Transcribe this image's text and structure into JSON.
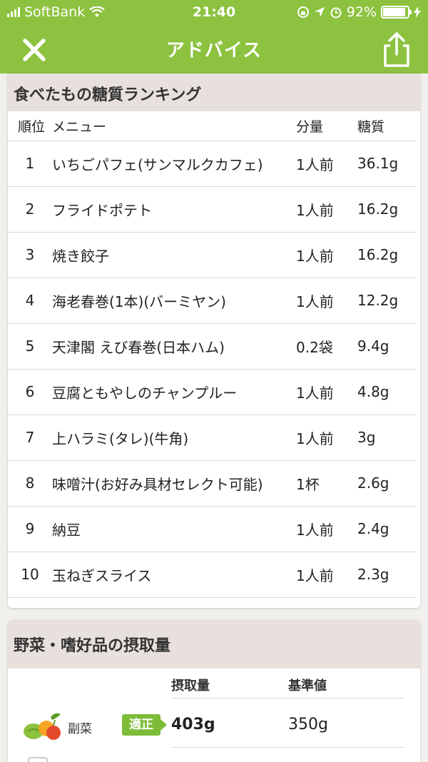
{
  "status": {
    "carrier": "SoftBank",
    "time": "21:40",
    "battery_pct": "92%",
    "battery_level": 0.92
  },
  "header": {
    "title": "アドバイス",
    "close_icon": "close-icon",
    "share_icon": "share-icon"
  },
  "ranking": {
    "title": "食べたもの糖質ランキング",
    "columns": {
      "rank": "順位",
      "menu": "メニュー",
      "amount": "分量",
      "carbs": "糖質"
    },
    "rows": [
      {
        "rank": "1",
        "menu": "いちごパフェ(サンマルクカフェ)",
        "amount": "1人前",
        "carbs": "36.1g"
      },
      {
        "rank": "2",
        "menu": "フライドポテト",
        "amount": "1人前",
        "carbs": "16.2g"
      },
      {
        "rank": "3",
        "menu": "焼き餃子",
        "amount": "1人前",
        "carbs": "16.2g"
      },
      {
        "rank": "4",
        "menu": "海老春巻(1本)(バーミヤン)",
        "amount": "1人前",
        "carbs": "12.2g"
      },
      {
        "rank": "5",
        "menu": "天津閣 えび春巻(日本ハム)",
        "amount": "0.2袋",
        "carbs": "9.4g"
      },
      {
        "rank": "6",
        "menu": "豆腐ともやしのチャンプルー",
        "amount": "1人前",
        "carbs": "4.8g"
      },
      {
        "rank": "7",
        "menu": "上ハラミ(タレ)(牛角)",
        "amount": "1人前",
        "carbs": "3g"
      },
      {
        "rank": "8",
        "menu": "味噌汁(お好み具材セレクト可能)",
        "amount": "1杯",
        "carbs": "2.6g"
      },
      {
        "rank": "9",
        "menu": "納豆",
        "amount": "1人前",
        "carbs": "2.4g"
      },
      {
        "rank": "10",
        "menu": "玉ねぎスライス",
        "amount": "1人前",
        "carbs": "2.3g"
      }
    ]
  },
  "intake": {
    "title": "野菜・嗜好品の摂取量",
    "col_intake": "摂取量",
    "col_standard": "基準値",
    "items": [
      {
        "label": "副菜",
        "icon": "vegetables-icon",
        "badge": "適正",
        "intake": "403g",
        "standard": "350g"
      }
    ]
  },
  "colors": {
    "brand": "#8cc23f",
    "badge": "#7cbc39",
    "header_bg": "#e8e0dc"
  }
}
